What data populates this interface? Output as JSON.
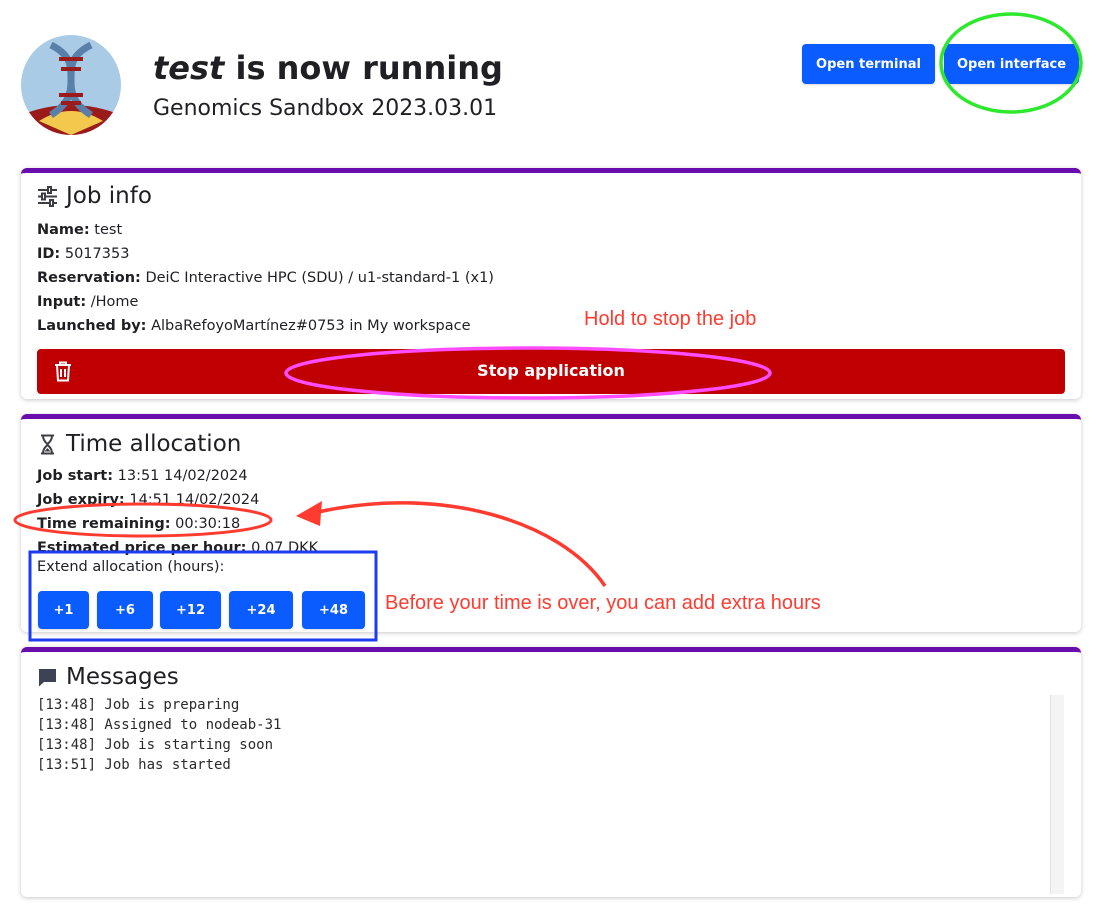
{
  "header": {
    "title_job": "test",
    "title_rest": " is now running",
    "subtitle": "Genomics Sandbox 2023.03.01",
    "logo_icon": "dna-app-logo-icon",
    "open_terminal": "Open terminal",
    "open_interface": "Open interface"
  },
  "job_info": {
    "title": "Job info",
    "icon": "sliders-icon",
    "fields": [
      {
        "label": "Name:",
        "value": "test"
      },
      {
        "label": "ID:",
        "value": "5017353"
      },
      {
        "label": "Reservation:",
        "value": "DeiC Interactive HPC (SDU) / u1-standard-1 (x1)"
      },
      {
        "label": "Input:",
        "value": "/Home"
      },
      {
        "label": "Launched by:",
        "value": "AlbaRefoyoMartínez#0753 in My workspace"
      }
    ],
    "stop_label": "Stop application",
    "stop_icon": "trash-icon"
  },
  "time_allocation": {
    "title": "Time allocation",
    "icon": "hourglass-icon",
    "fields": [
      {
        "label": "Job start:",
        "value": "13:51 14/02/2024"
      },
      {
        "label": "Job expiry:",
        "value": "14:51 14/02/2024"
      },
      {
        "label": "Time remaining:",
        "value": "00:30:18"
      },
      {
        "label": "Estimated price per hour:",
        "value": "0,07 DKK"
      }
    ],
    "extend_label": "Extend allocation (hours):",
    "extend_options": [
      "+1",
      "+6",
      "+12",
      "+24",
      "+48"
    ]
  },
  "messages": {
    "title": "Messages",
    "icon": "chat-icon",
    "log": [
      "[13:48] Job is preparing",
      "[13:48] Assigned to nodeab-31",
      "[13:48] Job is starting soon",
      "[13:51] Job has started"
    ]
  },
  "annotations": {
    "hold_note": "Hold to stop the job",
    "extend_note": "Before your time is over, you can add extra hours"
  },
  "colors": {
    "primary": "#0a5cff",
    "danger": "#c00000",
    "card_accent": "#6a0dad",
    "annotation_red": "#ff3b30",
    "annotation_green": "#2ee82e",
    "annotation_magenta": "#ff4dff",
    "annotation_blue": "#1d3cf0"
  }
}
